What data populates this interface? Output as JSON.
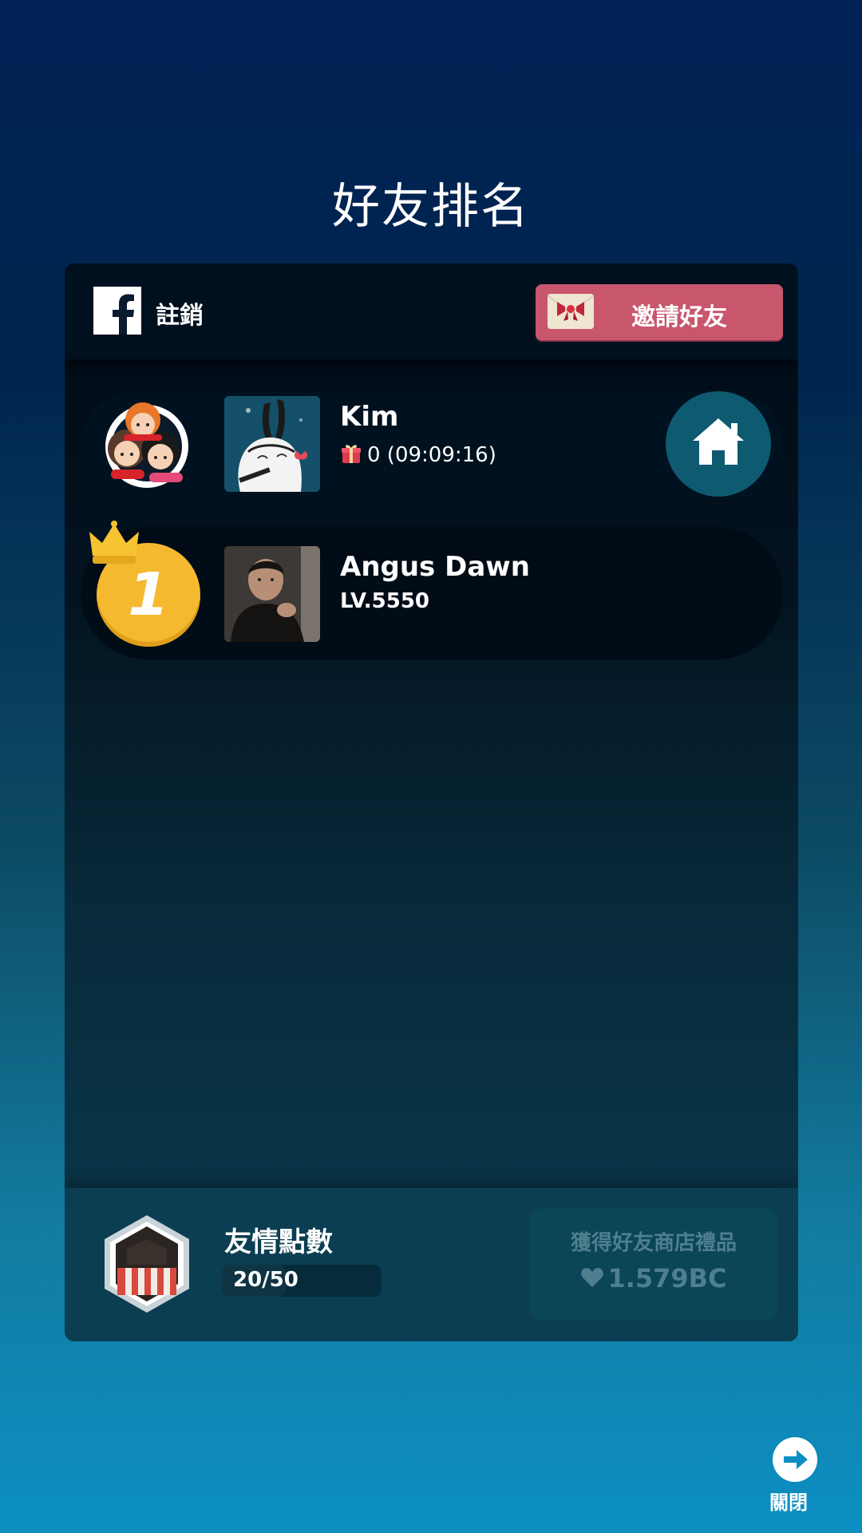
{
  "title": "好友排名",
  "header": {
    "logout_label": "註銷",
    "invite_label": "邀請好友"
  },
  "me": {
    "name": "Kim",
    "gift_count_text": "0 (09:09:16)"
  },
  "ranking": [
    {
      "rank": "1",
      "name": "Angus Dawn",
      "level": "LV.5550"
    }
  ],
  "footer": {
    "friend_points_label": "友情點數",
    "friend_points": "20/50",
    "friend_points_fraction": 0.4,
    "shop_label": "獲得好友商店禮品",
    "shop_value": "1.579BC"
  },
  "close_label": "關閉",
  "colors": {
    "invite_button": "#c8576e",
    "rank_gold": "#f4b92f",
    "home_button": "#0e5a70"
  },
  "icons": [
    "facebook-icon",
    "envelope-icon",
    "friends-badge-icon",
    "home-icon",
    "crown-icon",
    "gift-icon",
    "heart-icon",
    "arrow-right-icon"
  ]
}
